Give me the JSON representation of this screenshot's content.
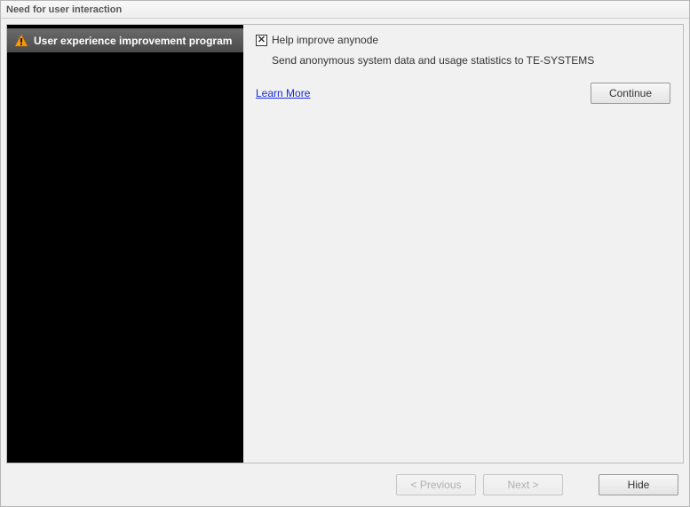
{
  "window": {
    "title": "Need for user interaction"
  },
  "sidebar": {
    "items": [
      {
        "label": "User experience improvement program",
        "icon": "warning"
      }
    ]
  },
  "content": {
    "checkbox_label": "Help improve anynode",
    "checkbox_checked": true,
    "description": "Send anonymous system data and usage statistics to TE-SYSTEMS",
    "learn_more": "Learn More",
    "continue_label": "Continue"
  },
  "footer": {
    "previous_label": "< Previous",
    "next_label": "Next >",
    "hide_label": "Hide",
    "previous_enabled": false,
    "next_enabled": false
  }
}
